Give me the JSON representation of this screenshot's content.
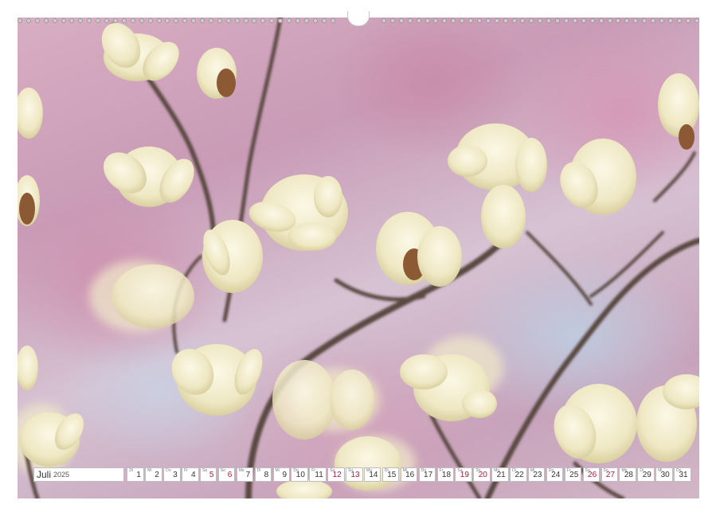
{
  "calendar": {
    "month": "Juli",
    "year": "2025",
    "weekend_color": "#a81c3c",
    "days": [
      {
        "num": "1",
        "wd": "Di",
        "weekend": false
      },
      {
        "num": "2",
        "wd": "Mi",
        "weekend": false
      },
      {
        "num": "3",
        "wd": "Do",
        "weekend": false
      },
      {
        "num": "4",
        "wd": "Fr",
        "weekend": false
      },
      {
        "num": "5",
        "wd": "Sa",
        "weekend": true
      },
      {
        "num": "6",
        "wd": "So",
        "weekend": true
      },
      {
        "num": "7",
        "wd": "Mo",
        "weekend": false
      },
      {
        "num": "8",
        "wd": "Di",
        "weekend": false
      },
      {
        "num": "9",
        "wd": "Mi",
        "weekend": false
      },
      {
        "num": "10",
        "wd": "Do",
        "weekend": false
      },
      {
        "num": "11",
        "wd": "Fr",
        "weekend": false
      },
      {
        "num": "12",
        "wd": "Sa",
        "weekend": true
      },
      {
        "num": "13",
        "wd": "So",
        "weekend": true
      },
      {
        "num": "14",
        "wd": "Mo",
        "weekend": false
      },
      {
        "num": "15",
        "wd": "Di",
        "weekend": false
      },
      {
        "num": "16",
        "wd": "Mi",
        "weekend": false
      },
      {
        "num": "17",
        "wd": "Do",
        "weekend": false
      },
      {
        "num": "18",
        "wd": "Fr",
        "weekend": false
      },
      {
        "num": "19",
        "wd": "Sa",
        "weekend": true
      },
      {
        "num": "20",
        "wd": "So",
        "weekend": true
      },
      {
        "num": "21",
        "wd": "Mo",
        "weekend": false
      },
      {
        "num": "22",
        "wd": "Di",
        "weekend": false
      },
      {
        "num": "23",
        "wd": "Mi",
        "weekend": false
      },
      {
        "num": "24",
        "wd": "Do",
        "weekend": false
      },
      {
        "num": "25",
        "wd": "Fr",
        "weekend": false
      },
      {
        "num": "26",
        "wd": "Sa",
        "weekend": true
      },
      {
        "num": "27",
        "wd": "So",
        "weekend": true
      },
      {
        "num": "28",
        "wd": "Mo",
        "weekend": false
      },
      {
        "num": "29",
        "wd": "Di",
        "weekend": false
      },
      {
        "num": "30",
        "wd": "Mi",
        "weekend": false
      },
      {
        "num": "31",
        "wd": "Do",
        "weekend": false
      }
    ]
  },
  "photo": {
    "subject": "magnolia-blossoms",
    "petal_color": "#f4efd2",
    "branch_color": "#5a4a42"
  }
}
